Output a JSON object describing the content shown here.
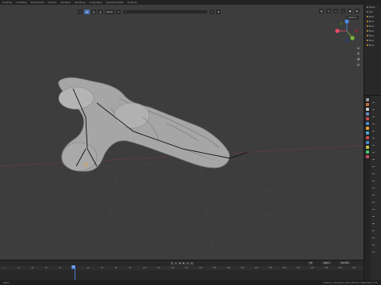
{
  "workspace_tabs": [
    "Sculpting",
    "UV Editing",
    "Texture Paint",
    "Shading",
    "Animation",
    "Rendering",
    "Compositing",
    "Geometry Nodes",
    "Scripting"
  ],
  "viewport": {
    "header": {
      "view_dropdown": "Global",
      "search_placeholder": "⌕"
    },
    "options_label": "Options",
    "gizmo": {
      "x_label": "X",
      "y_label": "Y",
      "z_label": "Z",
      "x_color": "#e84a5f",
      "y_color": "#7ab83a",
      "z_color": "#4a8ae8"
    }
  },
  "outliner": {
    "rows": [
      "Scene",
      "Coll",
      "Bone",
      "Bone",
      "Bone",
      "Bone",
      "Bone",
      "Bone",
      "Bone"
    ]
  },
  "timeline": {
    "current_frame": "30",
    "start_label": "Start",
    "start_value": "1",
    "end_label": "End",
    "end_value": "250",
    "ticks": [
      "0",
      "10",
      "20",
      "30",
      "40",
      "50",
      "60",
      "70",
      "80",
      "90",
      "100",
      "110",
      "120",
      "130",
      "140",
      "150",
      "160",
      "170",
      "180",
      "190",
      "200",
      "210",
      "220",
      "230",
      "240",
      "250"
    ]
  },
  "statusbar": {
    "left": "Select",
    "right": "Collection | Armature | Verts 100,210 | Objects 0/3 | 3.3.0"
  },
  "colors": {
    "viewport_bg": "#3d3d3d",
    "accent": "#4772b3",
    "selection": "#e8a23a"
  }
}
